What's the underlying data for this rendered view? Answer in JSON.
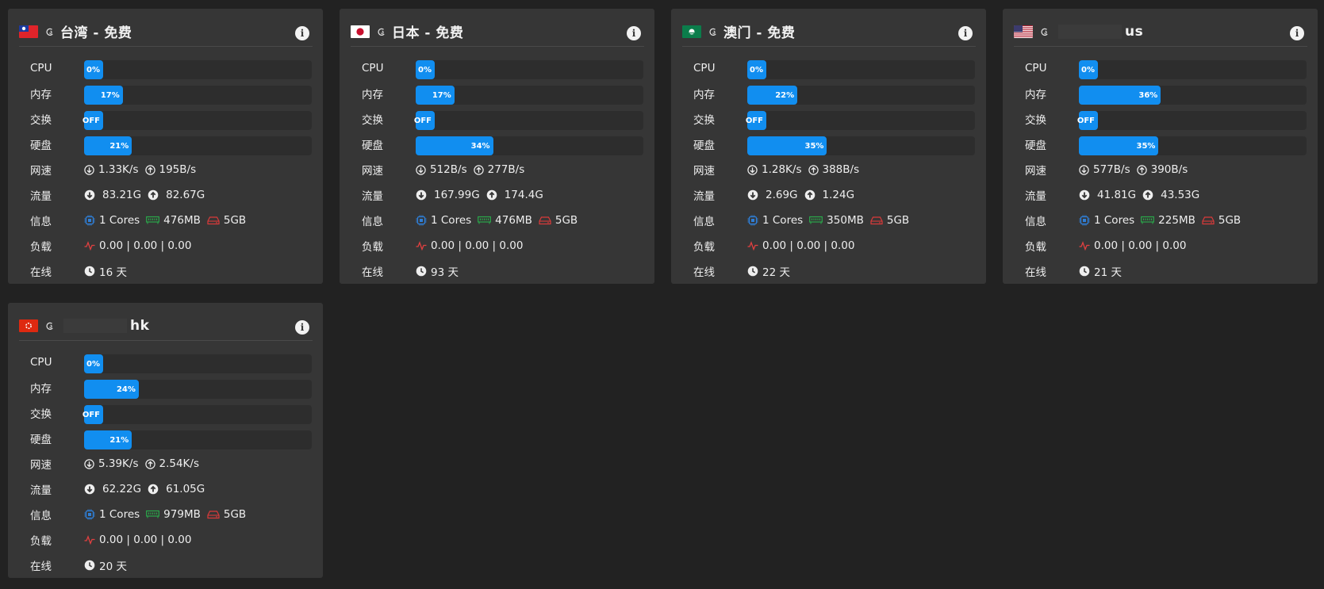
{
  "labels": {
    "cpu": "CPU",
    "mem": "内存",
    "swap": "交换",
    "disk": "硬盘",
    "net": "网速",
    "traffic": "流量",
    "info": "信息",
    "load": "负载",
    "uptime": "在线"
  },
  "icons": {
    "info": "info-icon",
    "os": "debian-icon",
    "down": "arrow-down-circle-icon",
    "up": "arrow-up-circle-icon",
    "cpu": "cpu-chip-icon",
    "ram": "memory-module-icon",
    "disk": "hard-drive-icon",
    "load": "activity-pulse-icon",
    "clock": "clock-icon"
  },
  "colors": {
    "bar": "#118ef0",
    "cpu_icon": "#2f7fd8",
    "ram_icon": "#2aa84a",
    "disk_icon": "#d93a3a",
    "load_icon": "#e04040"
  },
  "servers": [
    {
      "flag": "TW",
      "title": "台湾 - 免费",
      "cpu": "0%",
      "cpu_pct": 0,
      "mem": "17%",
      "mem_pct": 17,
      "swap": "OFF",
      "swap_pct": 0,
      "disk": "21%",
      "disk_pct": 21,
      "net_down": "1.33K/s",
      "net_up": "195B/s",
      "traffic_down": "83.21G",
      "traffic_up": "82.67G",
      "cores": "1 Cores",
      "ram": "476MB",
      "storage": "5GB",
      "load": "0.00 | 0.00 | 0.00",
      "uptime": "16 天"
    },
    {
      "flag": "JP",
      "title": "日本 - 免费",
      "cpu": "0%",
      "cpu_pct": 0,
      "mem": "17%",
      "mem_pct": 17,
      "swap": "OFF",
      "swap_pct": 0,
      "disk": "34%",
      "disk_pct": 34,
      "net_down": "512B/s",
      "net_up": "277B/s",
      "traffic_down": "167.99G",
      "traffic_up": "174.4G",
      "cores": "1 Cores",
      "ram": "476MB",
      "storage": "5GB",
      "load": "0.00 | 0.00 | 0.00",
      "uptime": "93 天"
    },
    {
      "flag": "MO",
      "title": "澳门 - 免费",
      "cpu": "0%",
      "cpu_pct": 0,
      "mem": "22%",
      "mem_pct": 22,
      "swap": "OFF",
      "swap_pct": 0,
      "disk": "35%",
      "disk_pct": 35,
      "net_down": "1.28K/s",
      "net_up": "388B/s",
      "traffic_down": "2.69G",
      "traffic_up": "1.24G",
      "cores": "1 Cores",
      "ram": "350MB",
      "storage": "5GB",
      "load": "0.00 | 0.00 | 0.00",
      "uptime": "22 天"
    },
    {
      "flag": "US",
      "title": "us",
      "cpu": "0%",
      "cpu_pct": 0,
      "mem": "36%",
      "mem_pct": 36,
      "swap": "OFF",
      "swap_pct": 0,
      "disk": "35%",
      "disk_pct": 35,
      "net_down": "577B/s",
      "net_up": "390B/s",
      "traffic_down": "41.81G",
      "traffic_up": "43.53G",
      "cores": "1 Cores",
      "ram": "225MB",
      "storage": "5GB",
      "load": "0.00 | 0.00 | 0.00",
      "uptime": "21 天"
    },
    {
      "flag": "HK",
      "title": "hk",
      "cpu": "0%",
      "cpu_pct": 0,
      "mem": "24%",
      "mem_pct": 24,
      "swap": "OFF",
      "swap_pct": 0,
      "disk": "21%",
      "disk_pct": 21,
      "net_down": "5.39K/s",
      "net_up": "2.54K/s",
      "traffic_down": "62.22G",
      "traffic_up": "61.05G",
      "cores": "1 Cores",
      "ram": "979MB",
      "storage": "5GB",
      "load": "0.00 | 0.00 | 0.00",
      "uptime": "20 天"
    }
  ]
}
